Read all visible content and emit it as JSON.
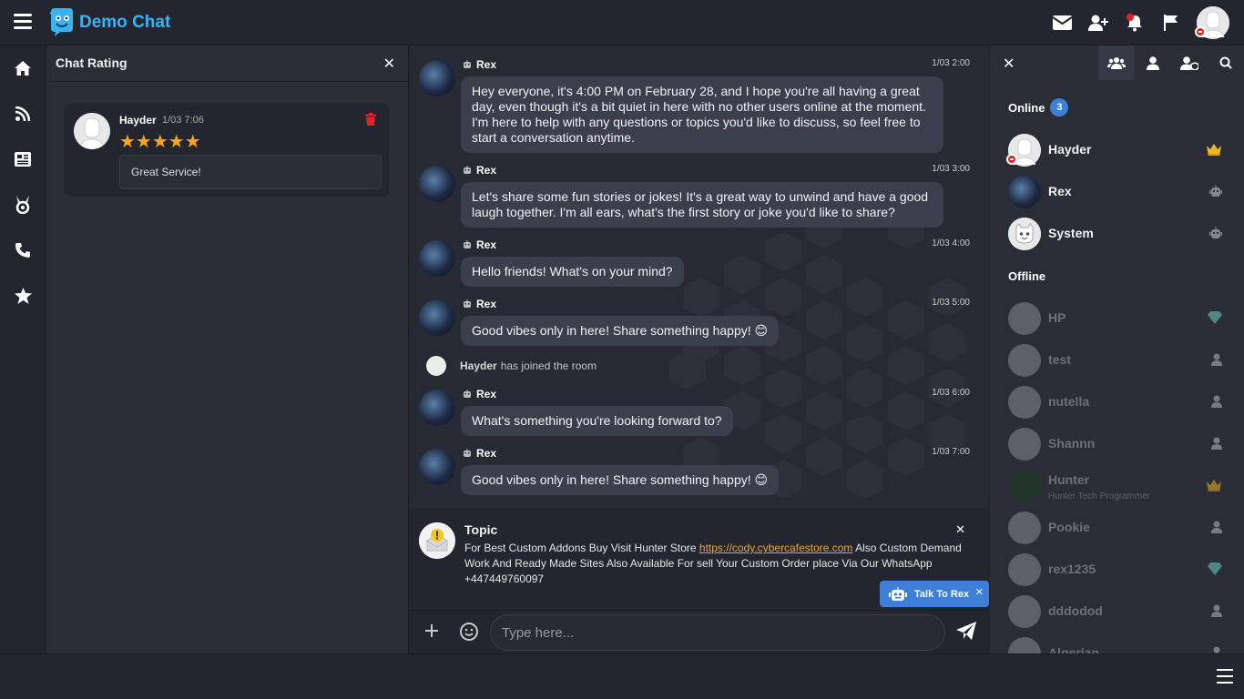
{
  "app": {
    "title": "Demo Chat"
  },
  "colors": {
    "accent": "#3d7fd6",
    "logo": "#3ab3f0",
    "star": "#f5a623",
    "danger": "#e0222a",
    "link": "#e8a838"
  },
  "header": {
    "icons": [
      "menu-icon",
      "envelope-icon",
      "add-friend-icon",
      "bell-icon",
      "flag-icon"
    ]
  },
  "sidebar": {
    "items": [
      "home-icon",
      "rss-icon",
      "news-icon",
      "badge-icon",
      "phone-icon",
      "star-icon"
    ]
  },
  "rating_panel": {
    "title": "Chat Rating",
    "close": "✕",
    "rating": {
      "name": "Hayder",
      "time": "1/03 7:06",
      "stars": "★★★★★",
      "comment": "Great Service!"
    }
  },
  "chat": {
    "messages": [
      {
        "name": "Rex",
        "time": "1/03 2:00",
        "text": "Hey everyone, it's 4:00 PM on February 28, and I hope you're all having a great day, even though it's a bit quiet in here with no other users online at the moment. I'm here to help with any questions or topics you'd like to discuss, so feel free to start a conversation anytime."
      },
      {
        "name": "Rex",
        "time": "1/03 3:00",
        "text": "Let's share some fun stories or jokes! It's a great way to unwind and have a good laugh together. I'm all ears, what's the first story or joke you'd like to share?"
      },
      {
        "name": "Rex",
        "time": "1/03 4:00",
        "text": "Hello friends! What's on your mind?"
      },
      {
        "name": "Rex",
        "time": "1/03 5:00",
        "text": "Good vibes only in here! Share something happy! 😊"
      },
      {
        "name": "Rex",
        "time": "1/03 6:00",
        "text": "What's something you're looking forward to?"
      },
      {
        "name": "Rex",
        "time": "1/03 7:00",
        "text": "Good vibes only in here! Share something happy! 😊"
      }
    ],
    "join": {
      "name": "Hayder",
      "text": "has joined the room"
    },
    "topic": {
      "title": "Topic",
      "text_before": "For Best Custom Addons Buy Visit Hunter Store ",
      "link": "https://cody.cybercafestore.com",
      "text_after": " Also Custom Demand Work And Ready Made Sites Also Available For sell Your Custom Order place Via Our WhatsApp +447449760097",
      "close": "✕"
    },
    "talk_button": {
      "label": "Talk To Rex",
      "close": "✕"
    },
    "input": {
      "placeholder": "Type here...",
      "value": ""
    }
  },
  "users_panel": {
    "close": "✕",
    "online_label": "Online",
    "online_count": "3",
    "offline_label": "Offline",
    "online": [
      {
        "name": "Hayder",
        "rank": "crown-icon"
      },
      {
        "name": "Rex",
        "rank": "bot-icon"
      },
      {
        "name": "System",
        "rank": "bot-icon"
      }
    ],
    "offline": [
      {
        "name": "HP",
        "rank": "diamond-icon"
      },
      {
        "name": "test",
        "rank": "user-icon"
      },
      {
        "name": "nutella",
        "rank": "user-icon"
      },
      {
        "name": "Shannn",
        "rank": "user-icon"
      },
      {
        "name": "Hunter",
        "sub": "Hunter Tech Programmer",
        "rank": "crown-icon"
      },
      {
        "name": "Pookie",
        "rank": "user-icon"
      },
      {
        "name": "rex1235",
        "rank": "diamond-icon"
      },
      {
        "name": "dddodod",
        "rank": "user-icon"
      },
      {
        "name": "Algerian",
        "rank": "user-icon"
      }
    ]
  }
}
